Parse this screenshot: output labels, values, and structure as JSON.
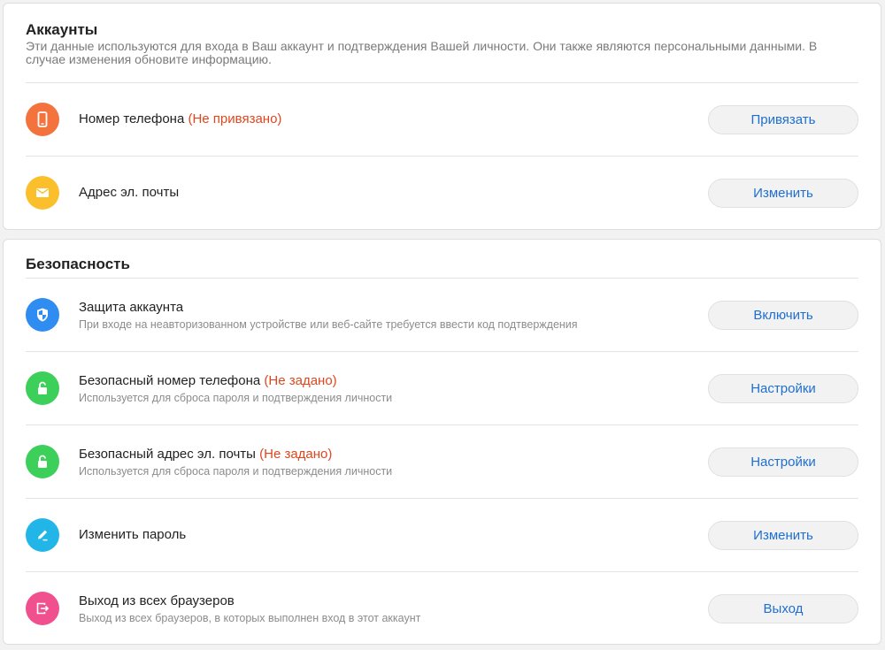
{
  "accounts": {
    "title": "Аккаунты",
    "description": "Эти данные используются для входа в Ваш аккаунт и подтверждения Вашей личности. Они также являются персональными данными. В случае изменения обновите информацию.",
    "items": [
      {
        "label": "Номер телефона",
        "status": "(Не привязано)",
        "button": "Привязать",
        "icon": "phone-icon",
        "color": "#f4733c"
      },
      {
        "label": "Адрес эл. почты",
        "status": "",
        "button": "Изменить",
        "icon": "mail-icon",
        "color": "#fbbf2c"
      }
    ]
  },
  "security": {
    "title": "Безопасность",
    "items": [
      {
        "label": "Защита аккаунта",
        "status": "",
        "sub": "При входе на неавторизованном устройстве или веб-сайте требуется ввести код подтверждения",
        "button": "Включить",
        "icon": "shield-icon",
        "color": "#2f8cf0"
      },
      {
        "label": "Безопасный номер телефона",
        "status": "(Не задано)",
        "sub": "Используется для сброса пароля и подтверждения личности",
        "button": "Настройки",
        "icon": "lock-icon",
        "color": "#3ccf5a"
      },
      {
        "label": "Безопасный адрес эл. почты",
        "status": "(Не задано)",
        "sub": "Используется для сброса пароля и подтверждения личности",
        "button": "Настройки",
        "icon": "lock-icon",
        "color": "#3ccf5a"
      },
      {
        "label": "Изменить пароль",
        "status": "",
        "sub": "",
        "button": "Изменить",
        "icon": "pencil-icon",
        "color": "#22b5e8"
      },
      {
        "label": "Выход из всех браузеров",
        "status": "",
        "sub": "Выход из всех браузеров, в которых выполнен вход в этот аккаунт",
        "button": "Выход",
        "icon": "logout-icon",
        "color": "#f0508e"
      }
    ]
  }
}
